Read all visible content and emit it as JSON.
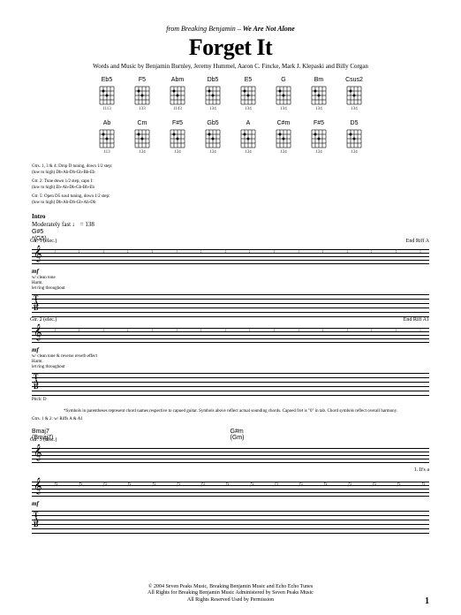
{
  "header": {
    "from": "from Breaking Benjamin –",
    "album": "We Are Not Alone",
    "title": "Forget It",
    "credits": "Words and Music by Benjamin Burnley, Jeremy Hummel, Aaron C. Fincke, Mark J. Klepaski and Billy Corgan"
  },
  "chords": {
    "row1": [
      {
        "name": "Eb5",
        "frets": "1113"
      },
      {
        "name": "F5",
        "frets": "133"
      },
      {
        "name": "Abm",
        "frets": "1143"
      },
      {
        "name": "Db5",
        "frets": "134"
      },
      {
        "name": "E5",
        "frets": "134"
      },
      {
        "name": "G",
        "frets": "134"
      },
      {
        "name": "Bm",
        "frets": "134"
      },
      {
        "name": "Csus2",
        "frets": "134"
      }
    ],
    "row2": [
      {
        "name": "Ab",
        "frets": "113"
      },
      {
        "name": "Cm",
        "frets": "134"
      },
      {
        "name": "F#5",
        "frets": "134"
      },
      {
        "name": "Gb5",
        "frets": "134"
      },
      {
        "name": "A",
        "frets": "134"
      },
      {
        "name": "C#m",
        "frets": "134"
      },
      {
        "name": "F#5",
        "frets": "134"
      },
      {
        "name": "D5",
        "frets": "134"
      }
    ]
  },
  "tuning": {
    "line1a": "Gtrs. 1, 3 & 4: Drop D tuning, down 1/2 step:",
    "line1b": "(low to high) Db-Ab-Db-Gb-Bb-Eb",
    "line2a": "Gtr. 2: Tune down 1/2 step, capo I:",
    "line2b": "(low to high) Eb-Ab-Db-Gb-Bb-Eb",
    "line3a": "Gtr. 5: Open D5 sus4 tuning, down 1/2 step:",
    "line3b": "(low to high) Db-Ab-Db-Gb-Ab-Db"
  },
  "intro": {
    "label": "Intro",
    "tempo": "Moderately fast ♩ = 138",
    "chord1": "G#5",
    "chord2": "*(G5)"
  },
  "staff1": {
    "gtr": "Gtr. 1 (elec.)",
    "riff": "Riff A",
    "endriff": "End Riff A",
    "dynamic": "mf",
    "note1": "w/ clean tone",
    "note2": "Harm.",
    "note3": "let ring throughout"
  },
  "staff2": {
    "gtr": "Gtr. 2 (elec.)",
    "riff": "Riff A1",
    "endriff": "End Riff A1",
    "dynamic": "mf",
    "note1": "w/ clean tone & reverse reverb effect",
    "note2": "Harm.",
    "note3": "let ring throughout",
    "pitch": "Pitch: D"
  },
  "asterisk": "*Symbols in parentheses represent chord names respective to capoed guitar. Symbols above reflect actual sounding chords. Capoed fret is \"0\" in tab. Chord symbols reflect overall harmony.",
  "section2": {
    "gtrlabel": "Gtrs. 1 & 2: w/ Riffs A & A1",
    "chord1a": "Bmaj7",
    "chord1b": "(Bmaj7)",
    "chord2a": "G#m",
    "chord2b": "(Gm)",
    "gtr3": "Gtr. 3 (elec.)",
    "dynamic": "mf",
    "lyric": "1. It's a"
  },
  "footer": {
    "line1": "© 2004 Seven Peaks Music, Breaking Benjamin Music and Echo Echo Tunes",
    "line2": "All Rights for Breaking Benjamin Music Administered by Seven Peaks Music",
    "line3": "All Rights Reserved   Used by Permission"
  },
  "page": "1"
}
